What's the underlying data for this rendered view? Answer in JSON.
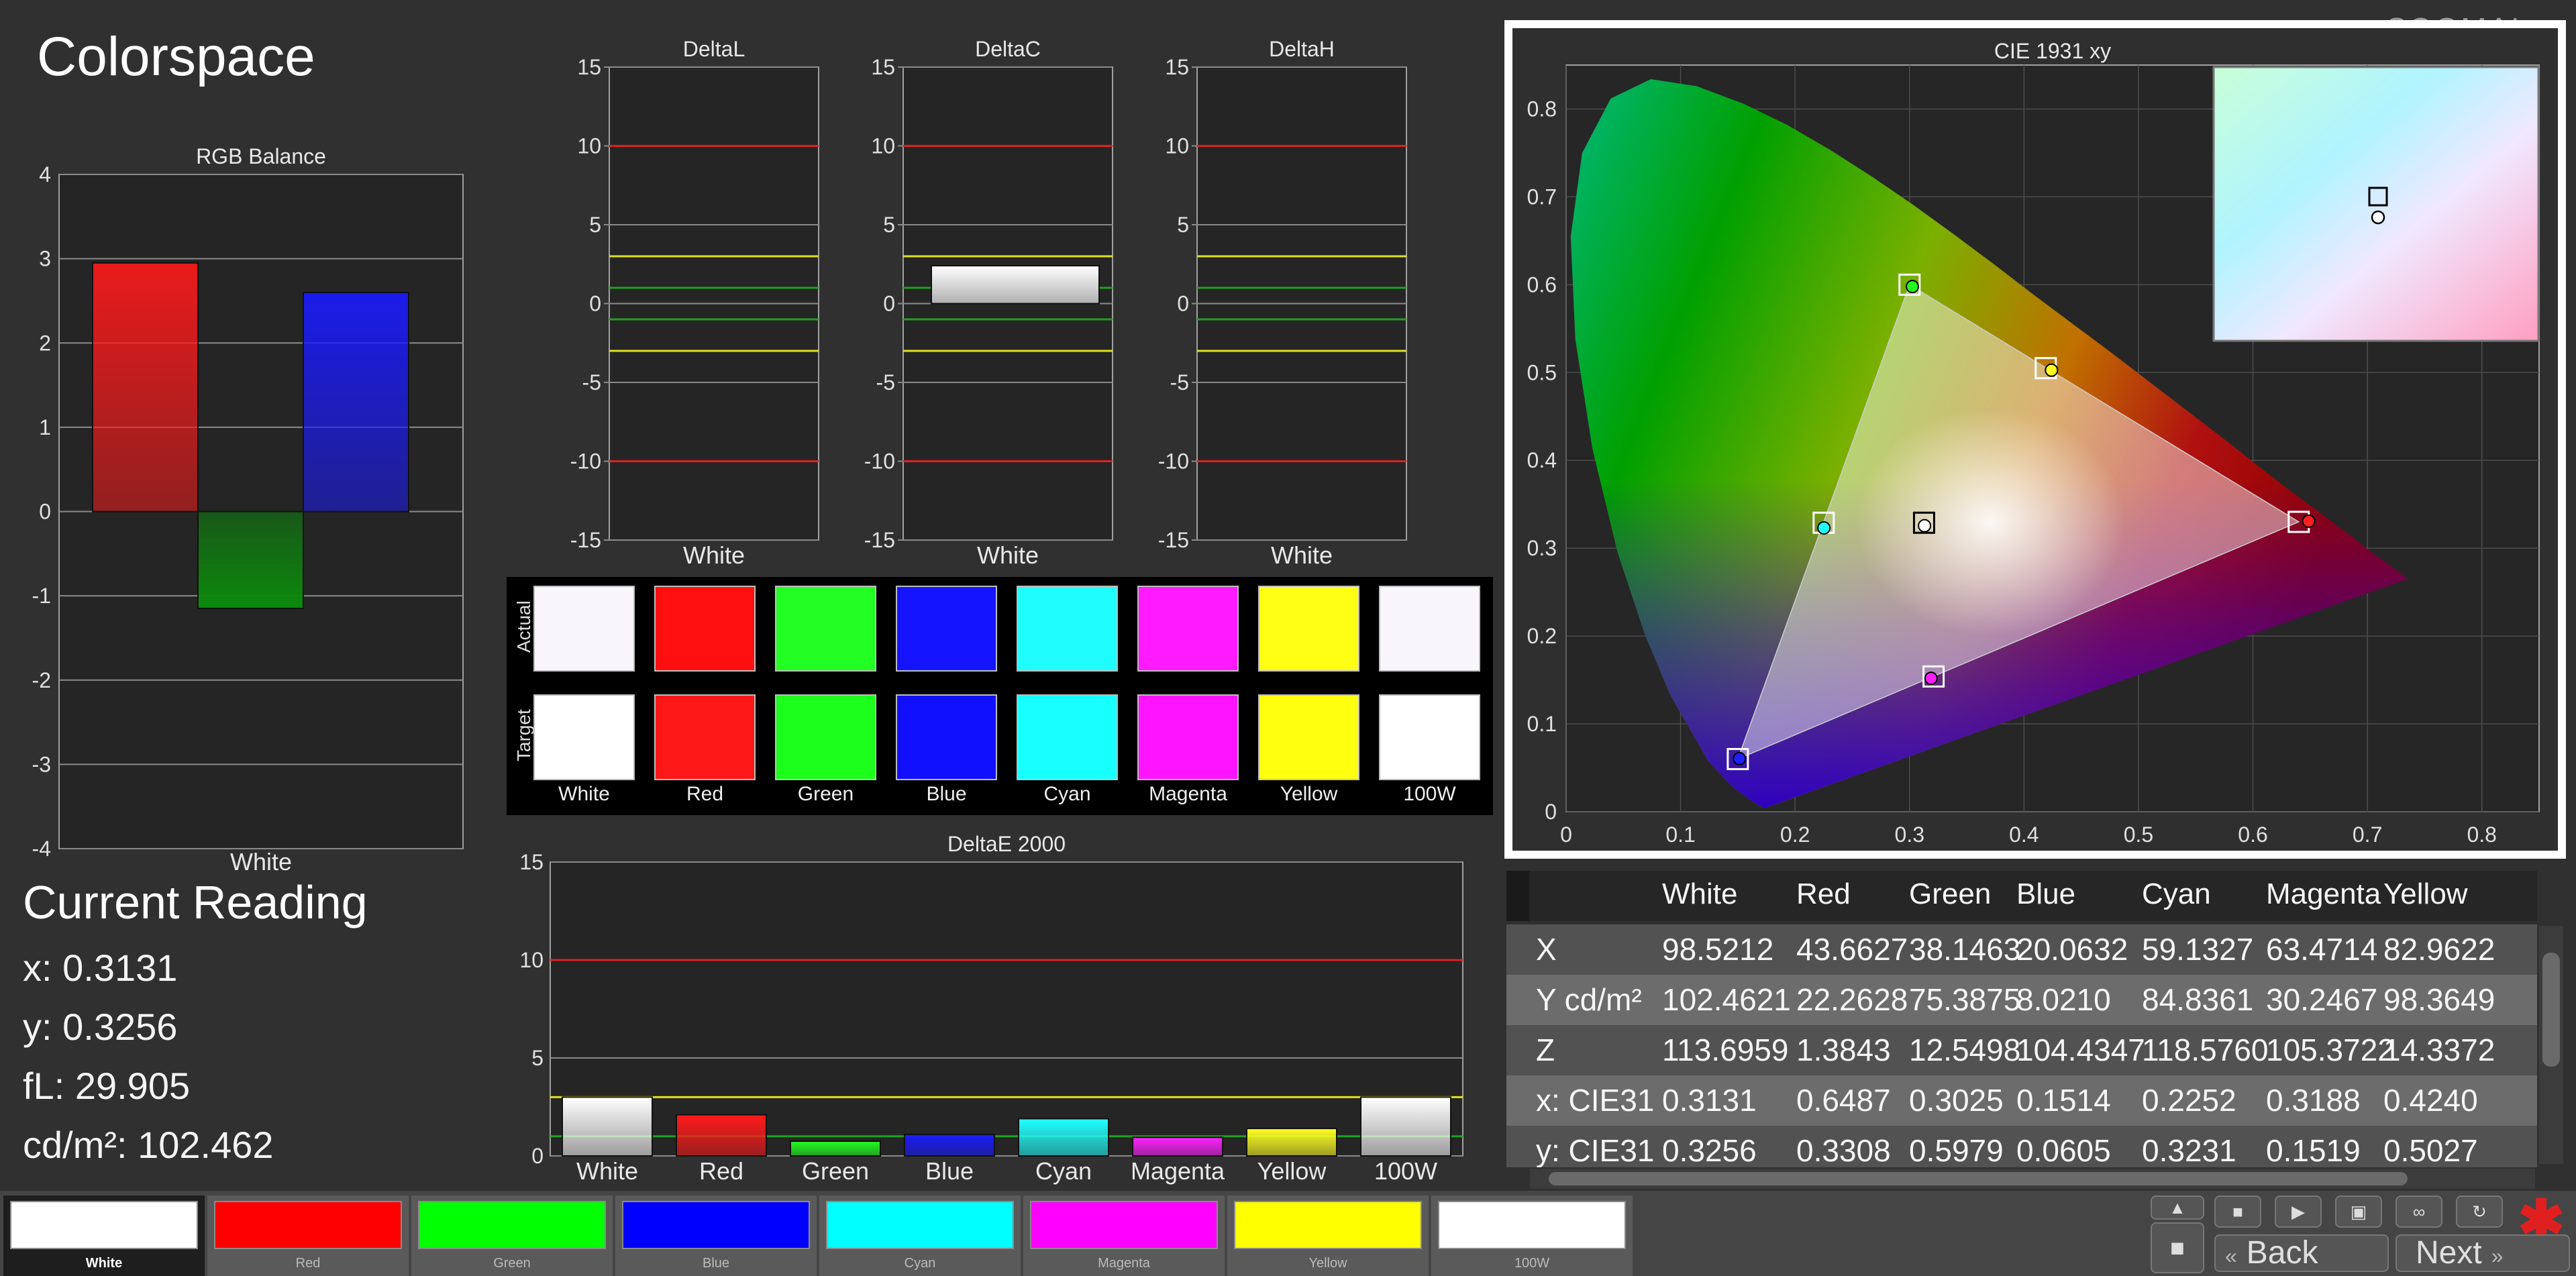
{
  "page_title": "Colorspace",
  "logo_text": "SOOMAL",
  "current_reading": {
    "title": "Current Reading",
    "lines": [
      "x: 0.3131",
      "y: 0.3256",
      "fL: 29.905",
      "cd/m²: 102.462"
    ]
  },
  "chart_data": [
    {
      "id": "rgb",
      "type": "bar",
      "title": "RGB Balance",
      "xlabel": "White",
      "categories": [
        "R",
        "G",
        "B"
      ],
      "values": [
        2.95,
        -1.15,
        2.6
      ],
      "colors": [
        "#ff1a1a",
        "#0c8a0c",
        "#1a1aff"
      ],
      "ylim": [
        -4,
        4
      ],
      "yticks": [
        "4",
        "3",
        "2",
        "1",
        "0",
        "-1",
        "-2",
        "-3",
        "-4"
      ]
    },
    {
      "id": "deltaL",
      "type": "bar",
      "title": "DeltaL",
      "xlabel": "White",
      "ylim": [
        -15,
        15
      ],
      "yticks": [
        "15",
        "10",
        "5",
        "0",
        "-5",
        "-10",
        "-15"
      ],
      "value": null
    },
    {
      "id": "deltaC",
      "type": "bar",
      "title": "DeltaC",
      "xlabel": "White",
      "ylim": [
        -15,
        15
      ],
      "yticks": [
        "15",
        "10",
        "5",
        "0",
        "-5",
        "-10",
        "-15"
      ],
      "value": 2.4
    },
    {
      "id": "deltaH",
      "type": "bar",
      "title": "DeltaH",
      "xlabel": "White",
      "ylim": [
        -15,
        15
      ],
      "yticks": [
        "15",
        "10",
        "5",
        "0",
        "-5",
        "-10",
        "-15"
      ],
      "value": null
    },
    {
      "id": "deltaE",
      "type": "bar",
      "title": "DeltaE 2000",
      "categories": [
        "White",
        "Red",
        "Green",
        "Blue",
        "Cyan",
        "Magenta",
        "Yellow",
        "100W"
      ],
      "values": [
        3.0,
        2.1,
        0.75,
        1.1,
        1.9,
        0.95,
        1.4,
        3.0
      ],
      "colors": [
        "#ffffff",
        "#ff1a1a",
        "#22ff22",
        "#1a1aff",
        "#22ffff",
        "#ff22ff",
        "#ffff22",
        "#ffffff"
      ],
      "ylim": [
        0,
        15
      ],
      "yticks": [
        "15",
        "10",
        "5",
        "0"
      ]
    },
    {
      "id": "cie",
      "type": "scatter",
      "title": "CIE 1931 xy",
      "xlim": [
        0,
        0.85
      ],
      "ylim": [
        0,
        0.85
      ],
      "xticks": [
        "0",
        "0.1",
        "0.2",
        "0.3",
        "0.4",
        "0.5",
        "0.6",
        "0.7",
        "0.8"
      ],
      "yticks": [
        "0",
        "0.1",
        "0.2",
        "0.3",
        "0.4",
        "0.5",
        "0.6",
        "0.7",
        "0.8"
      ],
      "targets": [
        {
          "x": 0.64,
          "y": 0.33
        },
        {
          "x": 0.3,
          "y": 0.6
        },
        {
          "x": 0.15,
          "y": 0.06
        },
        {
          "x": 0.225,
          "y": 0.329
        },
        {
          "x": 0.321,
          "y": 0.154
        },
        {
          "x": 0.419,
          "y": 0.505
        },
        {
          "x": 0.3127,
          "y": 0.329
        }
      ],
      "measured": [
        {
          "x": 0.6487,
          "y": 0.3308,
          "color": "#ff2020"
        },
        {
          "x": 0.3025,
          "y": 0.5979,
          "color": "#20ff20"
        },
        {
          "x": 0.1514,
          "y": 0.0605,
          "color": "#2020ff"
        },
        {
          "x": 0.2252,
          "y": 0.3231,
          "color": "#20ffff"
        },
        {
          "x": 0.3188,
          "y": 0.1519,
          "color": "#ff20ff"
        },
        {
          "x": 0.424,
          "y": 0.5027,
          "color": "#ffff20"
        },
        {
          "x": 0.3131,
          "y": 0.3256,
          "color": "#ffffff"
        }
      ]
    }
  ],
  "swatches": {
    "row_labels": [
      "Actual",
      "Target"
    ],
    "names": [
      "White",
      "Red",
      "Green",
      "Blue",
      "Cyan",
      "Magenta",
      "Yellow",
      "100W"
    ],
    "actual": [
      "#f8f6fa",
      "#ff0f0f",
      "#22ff22",
      "#1414ff",
      "#1efcfc",
      "#ff1aff",
      "#ffff14",
      "#f8f6fa"
    ],
    "target": [
      "#ffffff",
      "#ff1818",
      "#1cff1c",
      "#1010ff",
      "#18ffff",
      "#ff14ff",
      "#ffff10",
      "#ffffff"
    ]
  },
  "table": {
    "headers": [
      "White",
      "Red",
      "Green",
      "Blue",
      "Cyan",
      "Magenta",
      "Yellow"
    ],
    "rows": [
      {
        "label": "X",
        "values": [
          "98.5212",
          "43.6627",
          "38.1463",
          "20.0632",
          "59.1327",
          "63.4714",
          "82.9622"
        ]
      },
      {
        "label": "Y cd/m²",
        "values": [
          "102.4621",
          "22.2628",
          "75.3875",
          "8.0210",
          "84.8361",
          "30.2467",
          "98.3649"
        ]
      },
      {
        "label": "Z",
        "values": [
          "113.6959",
          "1.3843",
          "12.5498",
          "104.4347",
          "118.5760",
          "105.3722",
          "14.3372"
        ]
      },
      {
        "label": "x: CIE31",
        "values": [
          "0.3131",
          "0.6487",
          "0.3025",
          "0.1514",
          "0.2252",
          "0.3188",
          "0.4240"
        ]
      },
      {
        "label": "y: CIE31",
        "values": [
          "0.3256",
          "0.3308",
          "0.5979",
          "0.0605",
          "0.3231",
          "0.1519",
          "0.5027"
        ]
      }
    ]
  },
  "patches": [
    {
      "label": "White",
      "color": "#ffffff"
    },
    {
      "label": "Red",
      "color": "#ff0000"
    },
    {
      "label": "Green",
      "color": "#00ff00"
    },
    {
      "label": "Blue",
      "color": "#0000ff"
    },
    {
      "label": "Cyan",
      "color": "#00ffff"
    },
    {
      "label": "Magenta",
      "color": "#ff00ff"
    },
    {
      "label": "Yellow",
      "color": "#ffff00"
    },
    {
      "label": "100W",
      "color": "#ffffff"
    }
  ],
  "nav": {
    "back": "Back",
    "next": "Next"
  }
}
